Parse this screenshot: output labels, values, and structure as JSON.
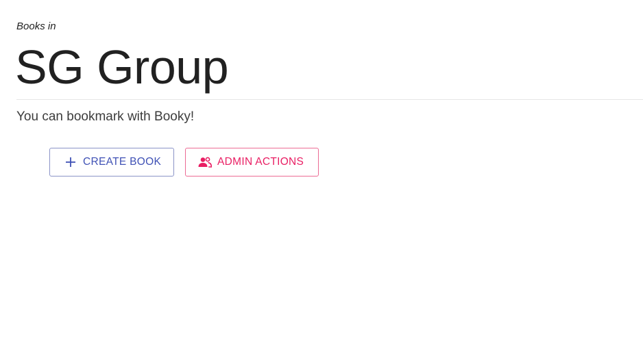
{
  "header": {
    "eyebrow": "Books in",
    "title": "SG Group",
    "subtitle": "You can bookmark with Booky!"
  },
  "actions": {
    "create_book": {
      "label": "CREATE BOOK",
      "icon": "plus-icon",
      "color": "#3f51b5"
    },
    "admin_actions": {
      "label": "ADMIN ACTIONS",
      "icon": "people-icon",
      "color": "#e91e63"
    }
  }
}
